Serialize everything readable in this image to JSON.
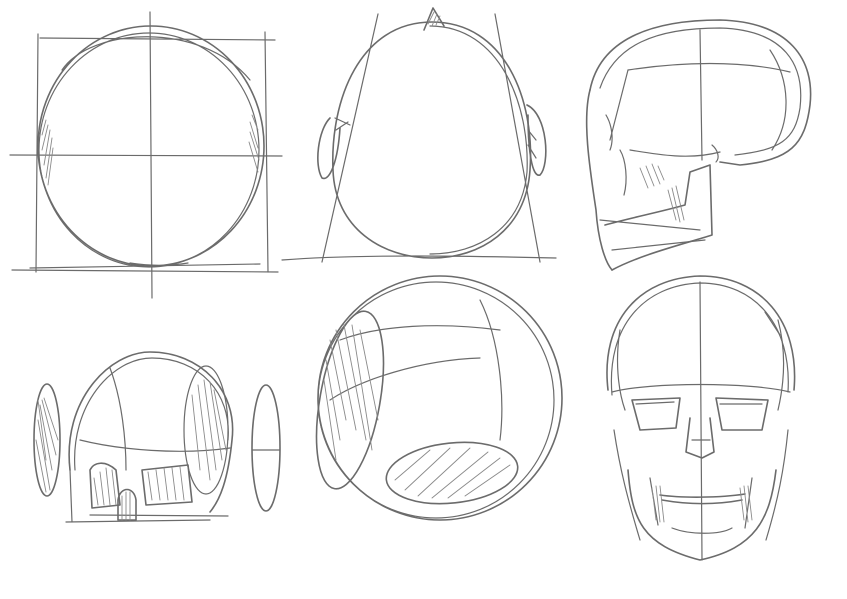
{
  "canvas": {
    "background": "#ffffff",
    "stroke_color": "#6b6b6b",
    "hatch_color": "#8a8a8a"
  },
  "sketches": [
    {
      "name": "head-front-construction"
    },
    {
      "name": "head-top-view-with-ears"
    },
    {
      "name": "skull-side-view"
    },
    {
      "name": "cranium-sphere-with-side-planes"
    },
    {
      "name": "cranium-sphere-three-quarter"
    },
    {
      "name": "skull-front-view"
    }
  ]
}
